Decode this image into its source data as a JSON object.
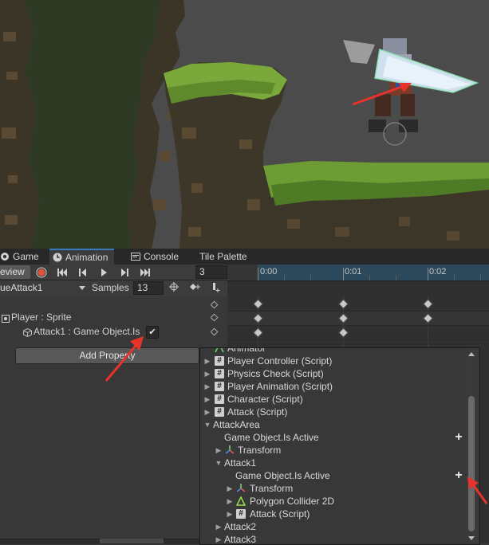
{
  "tabs": [
    {
      "label": "Game",
      "active": false
    },
    {
      "label": "Animation",
      "active": true
    },
    {
      "label": "Console",
      "active": false
    },
    {
      "label": "Tile Palette",
      "active": false
    }
  ],
  "toolbar": {
    "preview_label": "eview",
    "current_frame": "3",
    "clip_name": "ueAttack1",
    "samples_label": "Samples",
    "samples_value": "13"
  },
  "timeline": {
    "ruler_labels": [
      "0:00",
      "0:01",
      "0:02"
    ]
  },
  "properties": [
    {
      "label": "Player : Sprite"
    },
    {
      "label": "Attack1 : Game Object.Is",
      "checked": "✔"
    }
  ],
  "add_property_label": "Add Property",
  "popup": {
    "items": [
      {
        "label": "Animator",
        "kind": "component"
      },
      {
        "label": "Player Controller (Script)",
        "kind": "script"
      },
      {
        "label": "Physics Check (Script)",
        "kind": "script"
      },
      {
        "label": "Player Animation (Script)",
        "kind": "script"
      },
      {
        "label": "Character (Script)",
        "kind": "script"
      },
      {
        "label": "Attack (Script)",
        "kind": "script"
      },
      {
        "label": "AttackArea",
        "kind": "group-open"
      },
      {
        "label": "Game Object.Is Active",
        "kind": "property"
      },
      {
        "label": "Transform",
        "kind": "transform"
      },
      {
        "label": "Attack1",
        "kind": "group-open"
      },
      {
        "label": "Game Object.Is Active",
        "kind": "property"
      },
      {
        "label": "Transform",
        "kind": "transform"
      },
      {
        "label": "Polygon Collider 2D",
        "kind": "collider"
      },
      {
        "label": "Attack (Script)",
        "kind": "script"
      },
      {
        "label": "Attack2",
        "kind": "group"
      },
      {
        "label": "Attack3",
        "kind": "group"
      }
    ],
    "add_symbol": "+"
  },
  "colors": {
    "accent": "#3a79bb",
    "record": "#e0533a",
    "annotation": "#e8332a"
  }
}
